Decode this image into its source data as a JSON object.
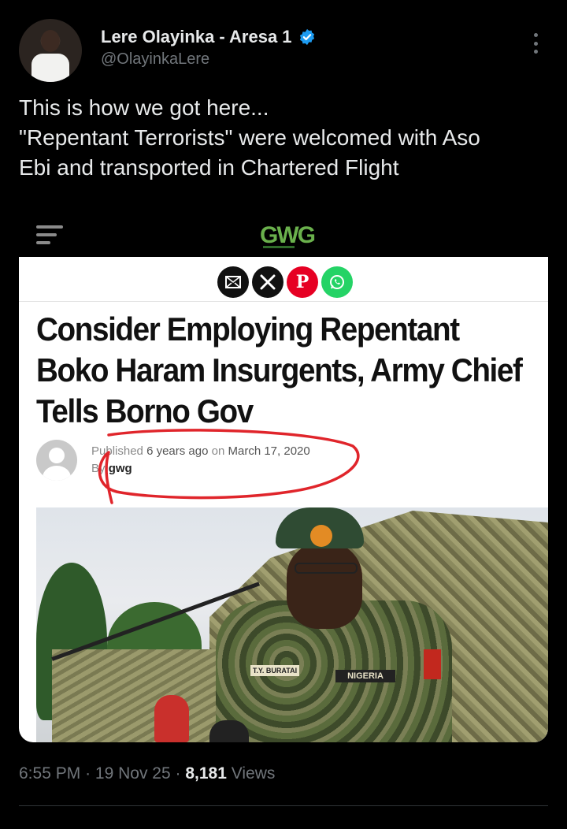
{
  "author": {
    "display_name": "Lere Olayinka - Aresa 1",
    "handle": "@OlayinkaLere",
    "verified": true,
    "verified_color": "#1d9bf0"
  },
  "tweet": {
    "lines": [
      "This is how we got here...",
      "\"Repentant Terrorists\" were welcomed with Aso",
      "Ebi and transported in Chartered Flight"
    ]
  },
  "media": {
    "site_logo": "GWG",
    "share_icons": [
      "email-icon",
      "x-icon",
      "pinterest-icon",
      "whatsapp-icon"
    ],
    "share_labels": {
      "pinterest": "P"
    },
    "headline_lines": [
      "Consider Employing Repentant",
      "Boko Haram Insurgents, Army Chief",
      "Tells Borno Gov"
    ],
    "published_prefix": "Published",
    "published_ago": "6 years ago",
    "published_on": "on",
    "published_date": "March 17, 2020",
    "by_prefix": "By",
    "by_author": "gwg",
    "photo_name_tag": "T.Y. BURATAI",
    "photo_country_tag": "NIGERIA",
    "annotation_color": "#e0252b"
  },
  "meta": {
    "time": "6:55 PM",
    "date": "19 Nov 25",
    "views_count": "8,181",
    "views_label": "Views",
    "separator": "·"
  }
}
